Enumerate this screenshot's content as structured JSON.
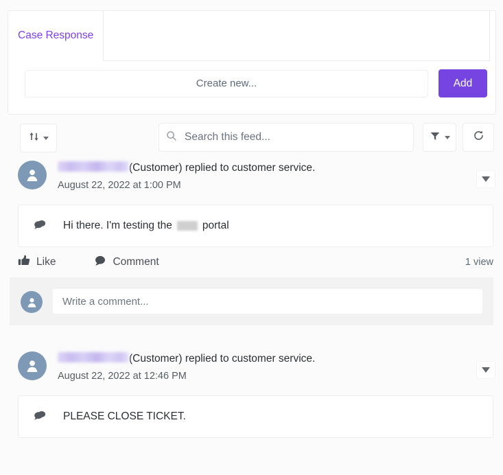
{
  "tabs": {
    "items": [
      {
        "label": "Case Response",
        "active": true
      }
    ]
  },
  "create": {
    "placeholder": "Create new...",
    "value": "",
    "add_label": "Add"
  },
  "toolbar": {
    "sort_icon": "sort-arrows-icon",
    "sort_caret_icon": "chevron-down-icon",
    "search_placeholder": "Search this feed...",
    "search_value": "",
    "search_icon": "search-icon",
    "filter_icon": "filter-funnel-icon",
    "filter_caret_icon": "chevron-down-icon",
    "refresh_icon": "refresh-icon"
  },
  "feed": {
    "posts": [
      {
        "author_redacted": true,
        "author_suffix": "(Customer) replied to customer service.",
        "timestamp": "August 22, 2022 at 1:00 PM",
        "body_prefix": "Hi there. I'm testing the",
        "body_redacted": true,
        "body_suffix": "portal",
        "body_icon": "speech-bubbles-icon",
        "menu_icon": "chevron-down-icon",
        "avatar_icon": "user-avatar-icon",
        "like_label": "Like",
        "like_icon": "thumbs-up-icon",
        "comment_label": "Comment",
        "comment_icon": "speech-bubble-icon",
        "views": "1 view",
        "comment_placeholder": "Write a comment...",
        "comment_value": ""
      },
      {
        "author_redacted": true,
        "author_suffix": "(Customer) replied to customer service.",
        "timestamp": "August 22, 2022 at 12:46 PM",
        "body_prefix": "PLEASE CLOSE TICKET.",
        "body_redacted": false,
        "body_suffix": "",
        "body_icon": "speech-bubbles-icon",
        "menu_icon": "chevron-down-icon",
        "avatar_icon": "user-avatar-icon"
      }
    ]
  },
  "colors": {
    "accent_purple": "#7644e0",
    "tab_text": "#7e3ff2",
    "avatar": "#7e99b5",
    "comment_band": "#f2f2f2"
  }
}
